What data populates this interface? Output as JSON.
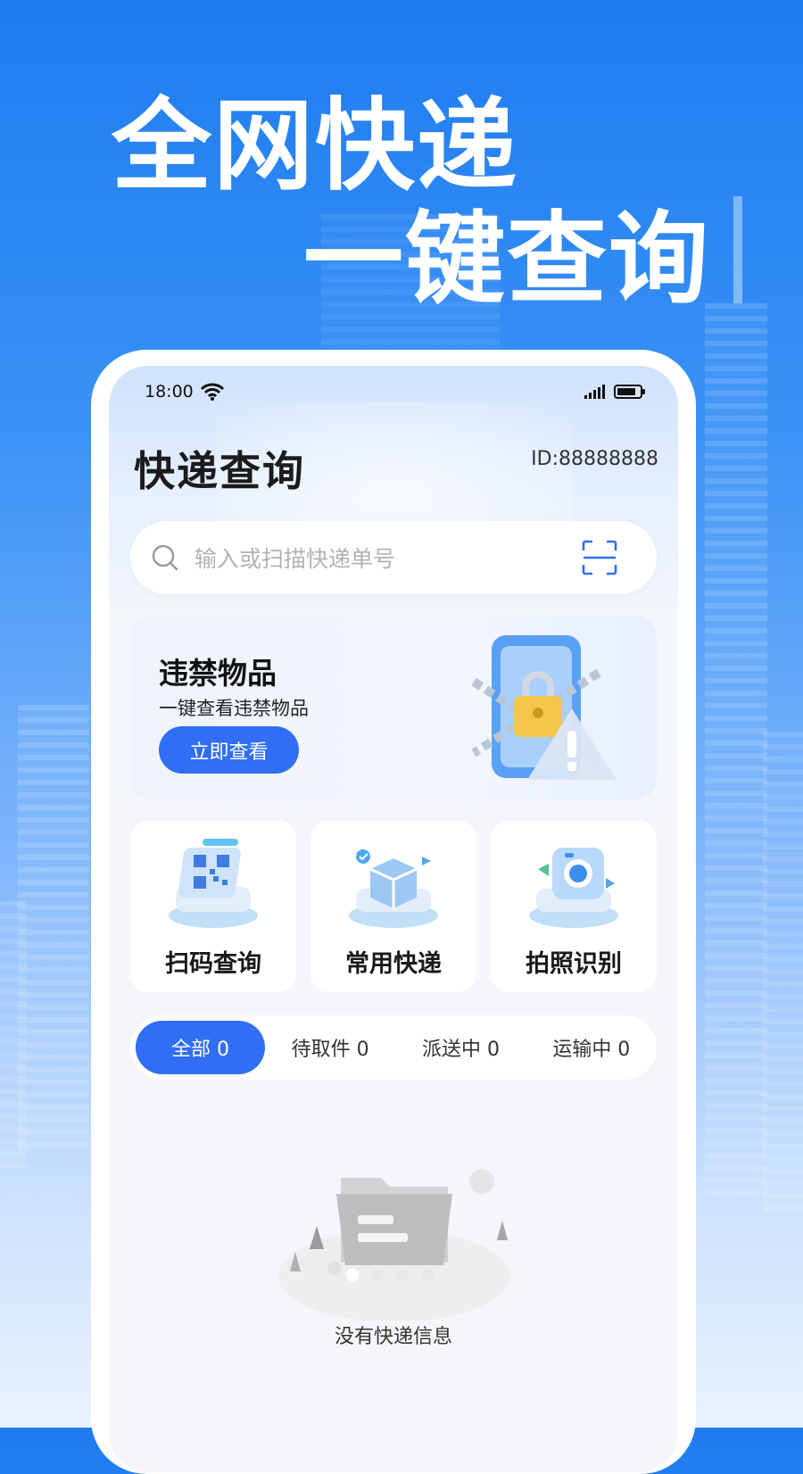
{
  "promo": {
    "headline_line1": "全网快递",
    "headline_line2": "一键查询"
  },
  "status_bar": {
    "time": "18:00"
  },
  "header": {
    "title": "快递查询",
    "user_id": "ID:88888888"
  },
  "search": {
    "placeholder": "输入或扫描快递单号"
  },
  "banner": {
    "title": "违禁物品",
    "subtitle": "一键查看违禁物品",
    "button_label": "立即查看"
  },
  "features": [
    {
      "label": "扫码查询",
      "icon": "qr-scan-icon"
    },
    {
      "label": "常用快递",
      "icon": "package-box-icon"
    },
    {
      "label": "拍照识别",
      "icon": "camera-icon"
    }
  ],
  "tabs": [
    {
      "label": "全部 0",
      "active": true
    },
    {
      "label": "待取件 0",
      "active": false
    },
    {
      "label": "派送中 0",
      "active": false
    },
    {
      "label": "运输中 0",
      "active": false
    }
  ],
  "empty_state": {
    "message": "没有快递信息"
  },
  "colors": {
    "primary": "#2f6ef5",
    "background_top": "#1f7cf0"
  }
}
